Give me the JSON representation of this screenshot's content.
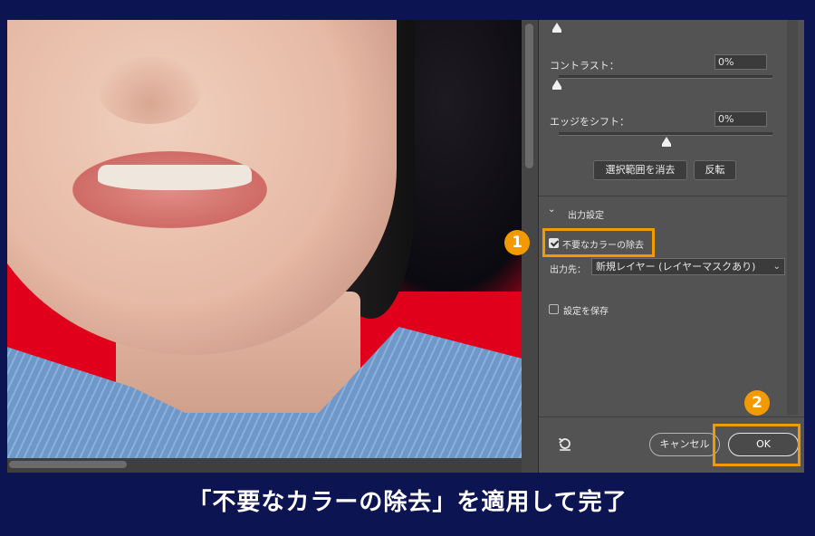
{
  "panel": {
    "contrast_label": "コントラスト：",
    "contrast_value": "0%",
    "edge_shift_label": "エッジをシフト：",
    "edge_shift_value": "0%",
    "clear_selection_button": "選択範囲を消去",
    "invert_button": "反転",
    "output_settings_header": "出力設定",
    "decontaminate_label": "不要なカラーの除去",
    "decontaminate_checked": true,
    "output_to_label": "出力先：",
    "output_to_value": "新規レイヤー (レイヤーマスクあり)",
    "save_settings_label": "設定を保存",
    "save_settings_checked": false,
    "cancel_button": "キャンセル",
    "ok_button": "OK"
  },
  "annotations": {
    "badge1": "1",
    "badge2": "2",
    "highlight_color": "#f39a00"
  },
  "caption": "「不要なカラーの除去」を適用して完了",
  "icons": {
    "collapse": "chevron-down-icon",
    "reset": "reset-icon"
  }
}
